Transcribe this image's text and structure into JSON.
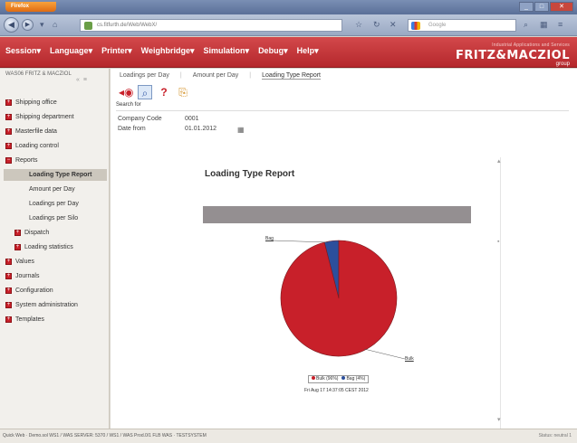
{
  "browser": {
    "app_button": "Firefox",
    "url": "cs.fitfurth.de/Web/WebX/",
    "search_placeholder": "Google"
  },
  "app": {
    "menu": [
      "Session",
      "Language",
      "Printer",
      "Weighbridge",
      "Simulation",
      "Debug",
      "Help"
    ],
    "brand_tagline": "Industrial Applications and Services",
    "brand_name": "FRITZ&MACZIOL",
    "brand_sub": "group"
  },
  "sidebar": {
    "header": "WAS06 FRITZ & MACZIOL",
    "items": [
      {
        "label": "Shipping office",
        "level": 0
      },
      {
        "label": "Shipping department",
        "level": 0
      },
      {
        "label": "Masterfile data",
        "level": 0
      },
      {
        "label": "Loading control",
        "level": 0
      },
      {
        "label": "Reports",
        "level": 0
      },
      {
        "label": "Loading Type Report",
        "level": 2,
        "selected": true
      },
      {
        "label": "Amount per Day",
        "level": 2
      },
      {
        "label": "Loadings per Day",
        "level": 2
      },
      {
        "label": "Loadings per Silo",
        "level": 2
      },
      {
        "label": "Dispatch",
        "level": 1
      },
      {
        "label": "Loading statistics",
        "level": 1
      },
      {
        "label": "Values",
        "level": 0
      },
      {
        "label": "Journals",
        "level": 0
      },
      {
        "label": "Configuration",
        "level": 0
      },
      {
        "label": "System administration",
        "level": 0
      },
      {
        "label": "Templates",
        "level": 0
      }
    ]
  },
  "main": {
    "tabs": [
      "Loadings per Day",
      "Amount per Day",
      "Loading Type Report"
    ],
    "active_tab": "Loading Type Report",
    "search_for_label": "Search for",
    "fields": [
      {
        "label": "Company Code",
        "value": "0001"
      },
      {
        "label": "Date from",
        "value": "01.01.2012"
      }
    ],
    "report_title": "Loading Type Report",
    "timestamp": "Fri Aug 17 14:37:05 CEST 2012"
  },
  "chart_data": {
    "type": "pie",
    "slices": [
      {
        "label": "Bulk",
        "value": 96,
        "color": "#c8202a"
      },
      {
        "label": "Bag",
        "value": 4,
        "color": "#2c4f9c"
      }
    ],
    "legend": [
      "Bulk (96%)",
      "Bag (4%)"
    ]
  },
  "statusbar": {
    "text": "Quick Web · Demo.sol       WS1 / WAS SERVER: 5370 / WS1 / WAS Prod.0/1       FLB WAS · TESTSYSTEM",
    "right": "Status: neutral 1"
  }
}
